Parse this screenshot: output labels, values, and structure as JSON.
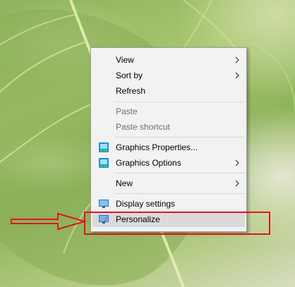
{
  "context_menu": {
    "items": [
      {
        "label": "View",
        "submenu": true
      },
      {
        "label": "Sort by",
        "submenu": true
      },
      {
        "label": "Refresh"
      },
      {
        "label": "Paste",
        "disabled": true
      },
      {
        "label": "Paste shortcut",
        "disabled": true
      },
      {
        "label": "Graphics Properties...",
        "icon": "intel-graphics-icon"
      },
      {
        "label": "Graphics Options",
        "icon": "intel-graphics-icon",
        "submenu": true
      },
      {
        "label": "New",
        "submenu": true
      },
      {
        "label": "Display settings",
        "icon": "display-icon"
      },
      {
        "label": "Personalize",
        "icon": "personalize-icon",
        "hovered": true
      }
    ]
  },
  "annotation": {
    "color": "#e0161e",
    "target": "Personalize"
  }
}
